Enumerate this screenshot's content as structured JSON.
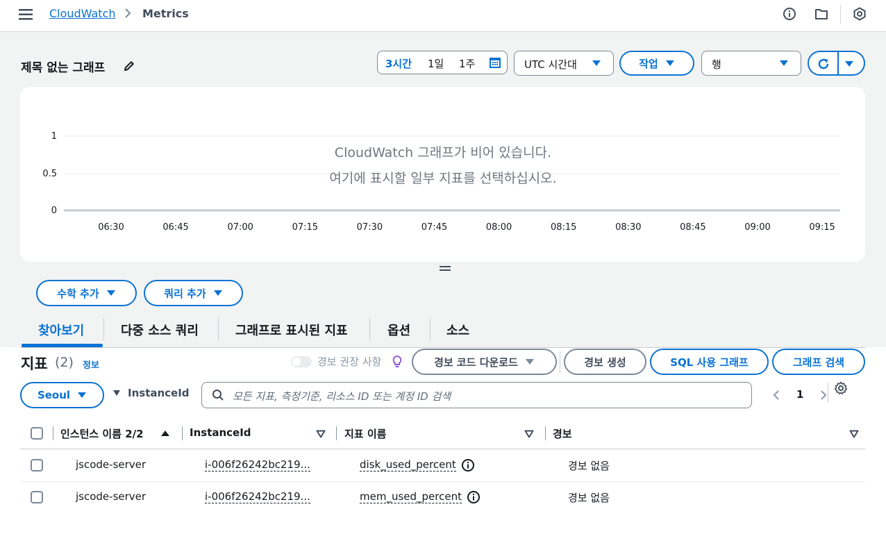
{
  "breadcrumb": {
    "root": "CloudWatch",
    "current": "Metrics"
  },
  "header": {
    "title": "제목 없는 그래프"
  },
  "time_range": {
    "options": [
      "3시간",
      "1일",
      "1주"
    ],
    "selected": "3시간"
  },
  "timezone": {
    "label": "UTC 시간대"
  },
  "actions": {
    "label": "작업"
  },
  "layout_select": {
    "value": "행"
  },
  "chart": {
    "empty_line1": "CloudWatch 그래프가 비어 있습니다.",
    "empty_line2": "여기에 표시할 일부 지표를 선택하십시오.",
    "yticks": [
      "1",
      "0.5",
      "0"
    ],
    "xticks": [
      "06:30",
      "06:45",
      "07:00",
      "07:15",
      "07:30",
      "07:45",
      "08:00",
      "08:15",
      "08:30",
      "08:45",
      "09:00",
      "09:15"
    ]
  },
  "buttons": {
    "add_math": "수학 추가",
    "add_query": "쿼리 추가"
  },
  "tabs": [
    "찾아보기",
    "다중 소스 쿼리",
    "그래프로 표시된 지표",
    "옵션",
    "소스"
  ],
  "metrics": {
    "title": "지표",
    "count": "(2)",
    "info": "정보",
    "alarm_recommend": "경보 권장 사항",
    "download_alarm_code": "경보 코드 다운로드",
    "create_alarm": "경보 생성",
    "sql_graph": "SQL 사용 그래프",
    "graph_search": "그래프 검색",
    "region": "Seoul",
    "filter_label": "InstanceId",
    "search_placeholder": "모든 지표, 측정기준, 리소스 ID 또는 계정 ID 검색",
    "page": "1"
  },
  "table": {
    "columns": [
      "인스턴스 이름 2/2",
      "InstanceId",
      "지표 이름",
      "경보"
    ],
    "rows": [
      {
        "name": "jscode-server",
        "instance_id": "i-006f26242bc219...",
        "metric": "disk_used_percent",
        "alarm": "경보 없음"
      },
      {
        "name": "jscode-server",
        "instance_id": "i-006f26242bc219...",
        "metric": "mem_used_percent",
        "alarm": "경보 없음"
      }
    ]
  }
}
